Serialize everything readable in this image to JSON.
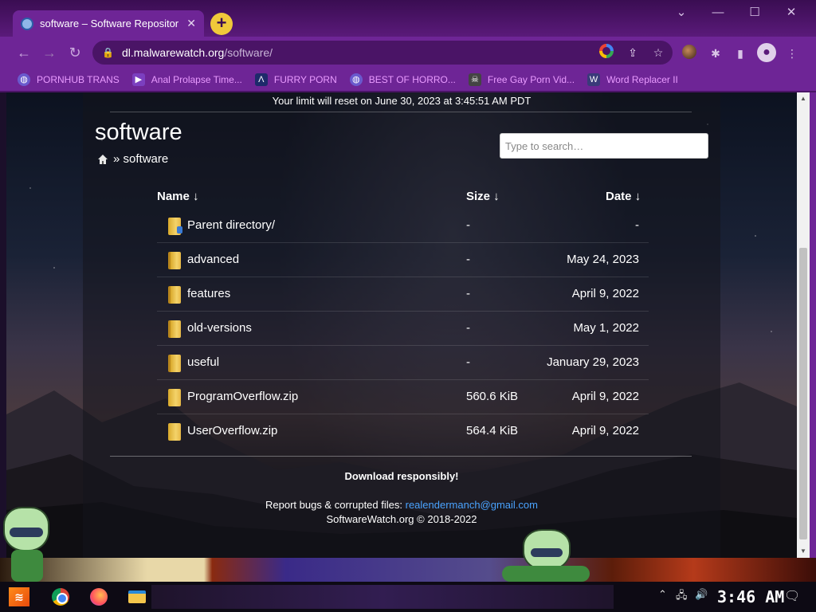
{
  "browser": {
    "tab_title": "software – Software Repositor",
    "tab_close": "✕",
    "new_tab": "+",
    "url_host": "dl.malwarewatch.org",
    "url_path": "/software/",
    "window_controls": [
      "⌄",
      "—",
      "☐",
      "✕"
    ]
  },
  "bookmarks": [
    {
      "label": "PORNHUB TRANS",
      "icon": "globe-icon",
      "color": "#6a5acd"
    },
    {
      "label": "Anal Prolapse Time...",
      "icon": "bookmark-icon",
      "color": "#7b3fbf"
    },
    {
      "label": "FURRY PORN",
      "icon": "lambda-icon",
      "color": "#1e2a6b"
    },
    {
      "label": "BEST OF HORRO...",
      "icon": "globe-icon",
      "color": "#6a5acd"
    },
    {
      "label": "Free Gay Porn Vid...",
      "icon": "skull-icon",
      "color": "#444"
    },
    {
      "label": "Word Replacer II",
      "icon": "wr-icon",
      "color": "#3a3a7a"
    }
  ],
  "page": {
    "limit_notice": "Your limit will reset on June 30, 2023 at 3:45:51 AM PDT",
    "title": "software",
    "breadcrumb_separator": "»",
    "breadcrumb_current": "software",
    "search_placeholder": "Type to search…",
    "headers": {
      "name": "Name ↓",
      "size": "Size ↓",
      "date": "Date ↓"
    },
    "rows": [
      {
        "name": "Parent directory/",
        "size": "-",
        "date": "-",
        "type": "parent"
      },
      {
        "name": "advanced",
        "size": "-",
        "date": "May 24, 2023",
        "type": "folder"
      },
      {
        "name": "features",
        "size": "-",
        "date": "April 9, 2022",
        "type": "folder"
      },
      {
        "name": "old-versions",
        "size": "-",
        "date": "May 1, 2022",
        "type": "folder"
      },
      {
        "name": "useful",
        "size": "-",
        "date": "January 29, 2023",
        "type": "folder"
      },
      {
        "name": "ProgramOverflow.zip",
        "size": "560.6 KiB",
        "date": "April 9, 2022",
        "type": "zip"
      },
      {
        "name": "UserOverflow.zip",
        "size": "564.4 KiB",
        "date": "April 9, 2022",
        "type": "zip"
      }
    ],
    "download_notice": "Download responsibly!",
    "report_label": "Report bugs & corrupted files:",
    "report_email": "realendermanch@gmail.com",
    "copyright": "SoftwareWatch.org © 2018-2022"
  },
  "taskbar": {
    "clock": "3:46 AM",
    "apps": [
      "start-icon",
      "chrome-icon",
      "firefox-icon",
      "file-explorer-icon"
    ]
  }
}
